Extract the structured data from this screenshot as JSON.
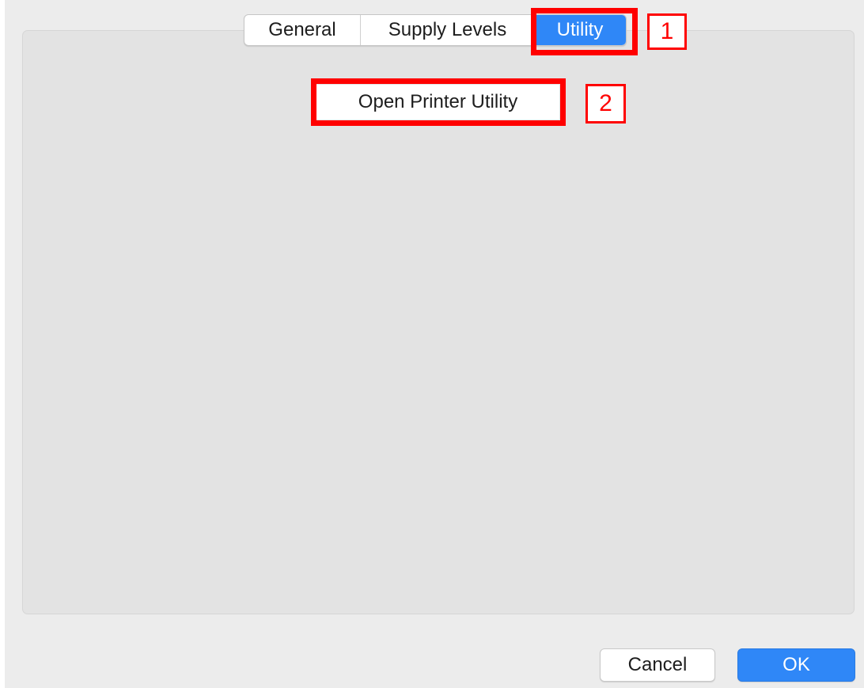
{
  "tabs": [
    {
      "label": "General",
      "selected": false
    },
    {
      "label": "Supply Levels",
      "selected": false
    },
    {
      "label": "Utility",
      "selected": true
    }
  ],
  "utility": {
    "open_printer_utility_label": "Open Printer Utility"
  },
  "callouts": [
    {
      "number": "1",
      "target": "Utility"
    },
    {
      "number": "2",
      "target": "Open Printer Utility"
    }
  ],
  "footer": {
    "cancel_label": "Cancel",
    "ok_label": "OK"
  },
  "colors": {
    "accent": "#2f87f7",
    "callout": "#ff0000",
    "panel": "#e3e3e3",
    "window": "#ececec"
  }
}
